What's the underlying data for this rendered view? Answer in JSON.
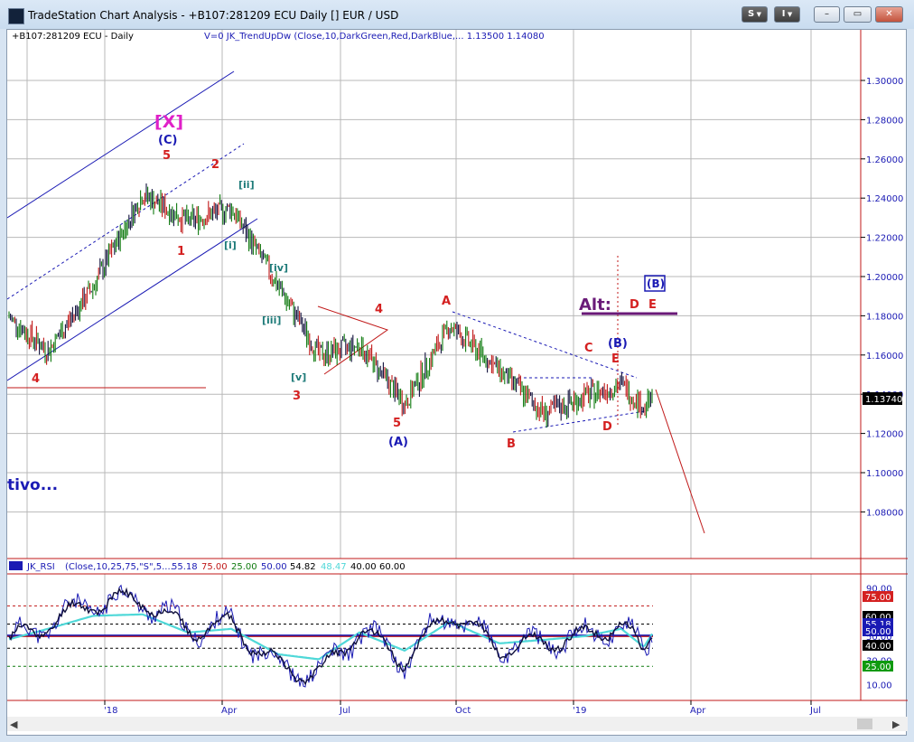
{
  "window": {
    "title": "TradeStation Chart Analysis - +B107:281209 ECU Daily [] EUR / USD",
    "s_menu_label": "S",
    "i_menu_label": "I",
    "minimize_glyph": "–",
    "maximize_glyph": "▭",
    "close_glyph": "✕"
  },
  "chart_header": {
    "symbol_label": "+B107:281209 ECU - Daily",
    "indicator_label": "V=0  JK_TrendUpDw  (Close,10,DarkGreen,Red,DarkBlue,...  1.13500  1.14080"
  },
  "price_axis": {
    "ticks": [
      "1.30000",
      "1.28000",
      "1.26000",
      "1.24000",
      "1.22000",
      "1.20000",
      "1.18000",
      "1.16000",
      "1.14000",
      "1.12000",
      "1.10000",
      "1.08000"
    ],
    "last_price": "1.13740"
  },
  "time_axis": {
    "labels": [
      "'18",
      "Apr",
      "Jul",
      "Oct",
      "'19",
      "Apr",
      "Jul"
    ]
  },
  "wave_labels": {
    "x_bracket": "[X]",
    "c_paren": "(C)",
    "five_top": "5",
    "two": "2",
    "one": "1",
    "ii": "[ii]",
    "i": "[i]",
    "iv": "[iv]",
    "iii": "[iii]",
    "v": "[v]",
    "three": "3",
    "four_left": "4",
    "four_mid": "4",
    "five_mid": "5",
    "a_paren": "(A)",
    "a": "A",
    "b": "B",
    "c": "C",
    "d_low": "D",
    "e_low": "E",
    "b_paren_blue": "(B)",
    "alt": "Alt:",
    "d_alt": "D",
    "e_alt": "E",
    "b_paren_boxed": "(B)",
    "side_text": "tivo..."
  },
  "rsi_panel": {
    "header": {
      "name": "JK_RSI",
      "params": "(Close,10,25,75,\"S\",5....",
      "v1": "55.18",
      "v2": "75.00",
      "v3": "25.00",
      "v4": "50.00",
      "v5": "54.82",
      "v6": "48.47",
      "v7": "40.00",
      "v8": "60.00"
    },
    "axis_ticks": [
      "90.00",
      "60.00",
      "50.00",
      "30.00",
      "10.00"
    ],
    "badges": {
      "b75": "75.00",
      "b60": "60.00",
      "b5518": "55.18",
      "b50": "50.00",
      "b40": "40.00",
      "b25": "25.00"
    }
  },
  "chart_data": {
    "type": "line",
    "title": "+B107:281209 ECU - Daily",
    "x": [
      "2017-11",
      "2017-12",
      "2018-01",
      "2018-02",
      "2018-03",
      "2018-04",
      "2018-05",
      "2018-06",
      "2018-07",
      "2018-08",
      "2018-09",
      "2018-10",
      "2018-11",
      "2018-12",
      "2019-01",
      "2019-02",
      "2019-03"
    ],
    "series": [
      {
        "name": "EUR / USD",
        "values": [
          1.18,
          1.162,
          1.195,
          1.242,
          1.228,
          1.235,
          1.195,
          1.16,
          1.165,
          1.135,
          1.175,
          1.152,
          1.13,
          1.139,
          1.145,
          1.133,
          1.1374
        ]
      },
      {
        "name": "JK_RSI",
        "values": [
          45,
          60,
          78,
          80,
          55,
          60,
          25,
          18,
          55,
          30,
          70,
          40,
          45,
          50,
          60,
          35,
          55.18
        ]
      }
    ],
    "ylim": [
      1.06,
      1.31
    ],
    "rsi_levels": [
      75,
      60,
      50,
      40,
      25
    ]
  },
  "colors": {
    "bullish": "#0f7a0f",
    "bearish": "#c01818",
    "neutral": "#10103c",
    "wave_red": "#d42020",
    "wave_blue": "#1a1ab4",
    "magenta": "#e020c8",
    "teal": "#1d7a78",
    "alt_purple": "#6a1a78",
    "grid": "#b8b8b8"
  }
}
